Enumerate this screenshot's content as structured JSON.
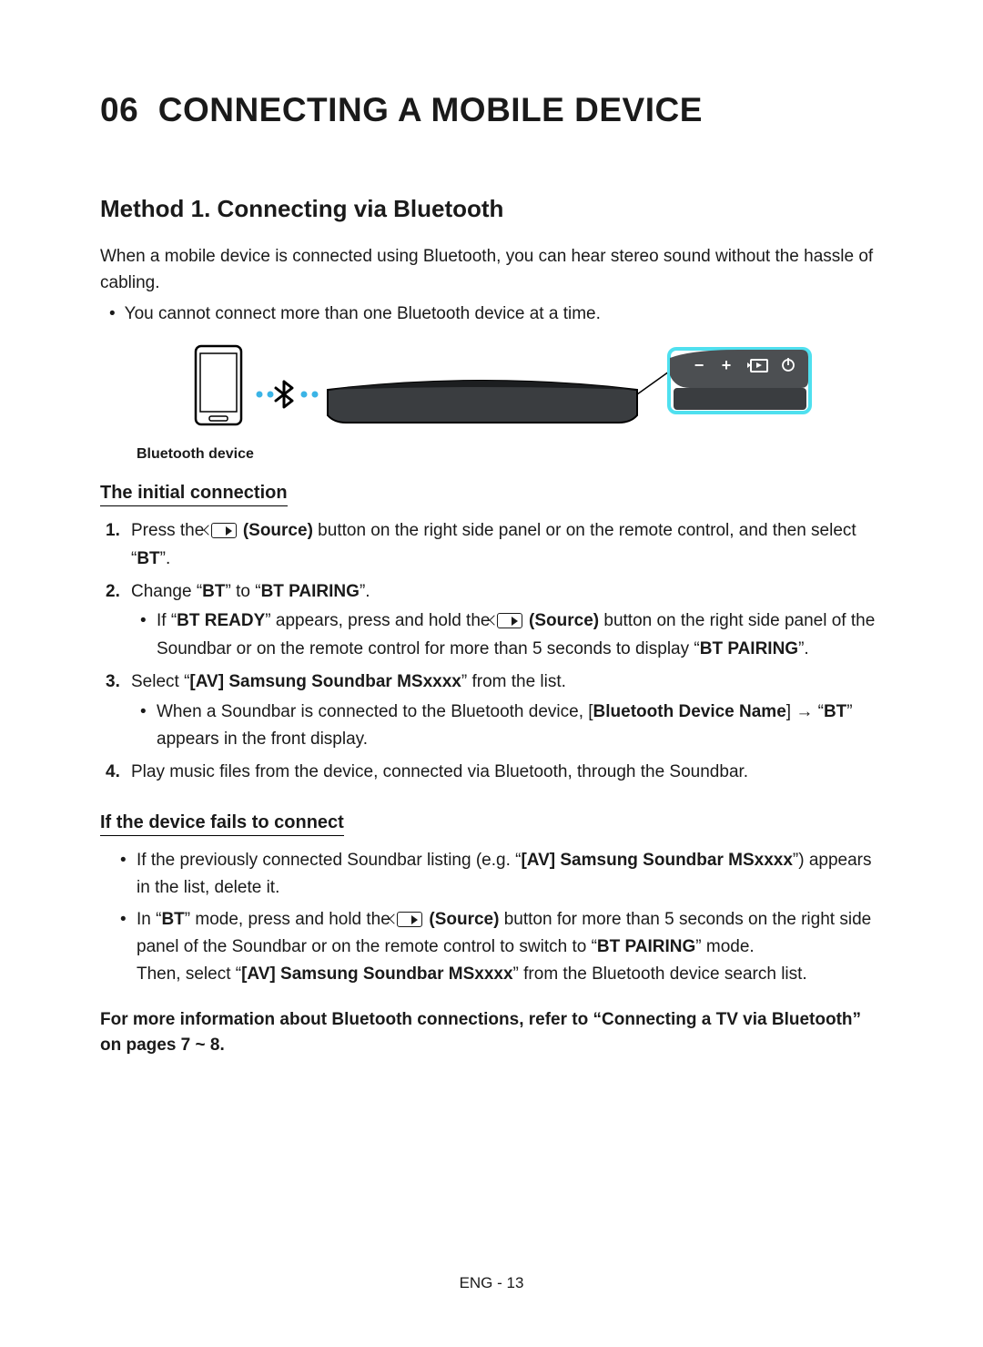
{
  "chapter_num": "06",
  "chapter_title": "CONNECTING A MOBILE DEVICE",
  "method_heading": "Method 1. Connecting via Bluetooth",
  "intro": "When a mobile device is connected using Bluetooth, you can hear stereo sound without the hassle of cabling.",
  "top_bullet": "You cannot connect more than one Bluetooth device at a time.",
  "diagram_caption": "Bluetooth device",
  "subhead1": "The initial connection",
  "steps": [
    {
      "pre": "Press the ",
      "source_label": "(Source)",
      "post": " button on the right side panel or on the remote control, and then select “",
      "bold_end": "BT",
      "tail": "”."
    },
    {
      "text_parts": [
        "Change “",
        "BT",
        "” to “",
        "BT PAIRING",
        "”."
      ],
      "sub": {
        "pre": "If “",
        "b1": "BT READY",
        "mid1": "” appears, press and hold the ",
        "source_label": "(Source)",
        "mid2": " button on the right side panel of the Soundbar or on the remote control for more than 5 seconds to display “",
        "b2": "BT PAIRING",
        "tail": "”."
      }
    },
    {
      "text_parts": [
        "Select “",
        "[AV] Samsung Soundbar MSxxxx",
        "” from the list."
      ],
      "sub": {
        "pre": "When a Soundbar is connected to the Bluetooth device, [",
        "b1": "Bluetooth Device Name",
        "mid": "] → “",
        "b2": "BT",
        "tail": "” appears in the front display."
      }
    },
    {
      "plain": "Play music files from the device, connected via Bluetooth, through the Soundbar."
    }
  ],
  "subhead2": "If the device fails to connect",
  "fail_bullets": [
    {
      "pre": "If the previously connected Soundbar listing (e.g. “",
      "b1": "[AV] Samsung Soundbar MSxxxx",
      "tail": "”) appears in the list, delete it."
    },
    {
      "pre": "In “",
      "b1": "BT",
      "mid1": "” mode, press and hold the ",
      "source_label": "(Source)",
      "mid2": " button for more than 5 seconds on the right side panel of the Soundbar or on the remote control to switch to “",
      "b2": "BT PAIRING",
      "mid3": "” mode.",
      "line2_pre": "Then, select “",
      "line2_b": "[AV] Samsung Soundbar MSxxxx",
      "line2_tail": "” from the Bluetooth device search list."
    }
  ],
  "more_info": "For more information about Bluetooth connections, refer to “Connecting a TV via Bluetooth” on pages 7 ~ 8.",
  "footer": "ENG - 13"
}
